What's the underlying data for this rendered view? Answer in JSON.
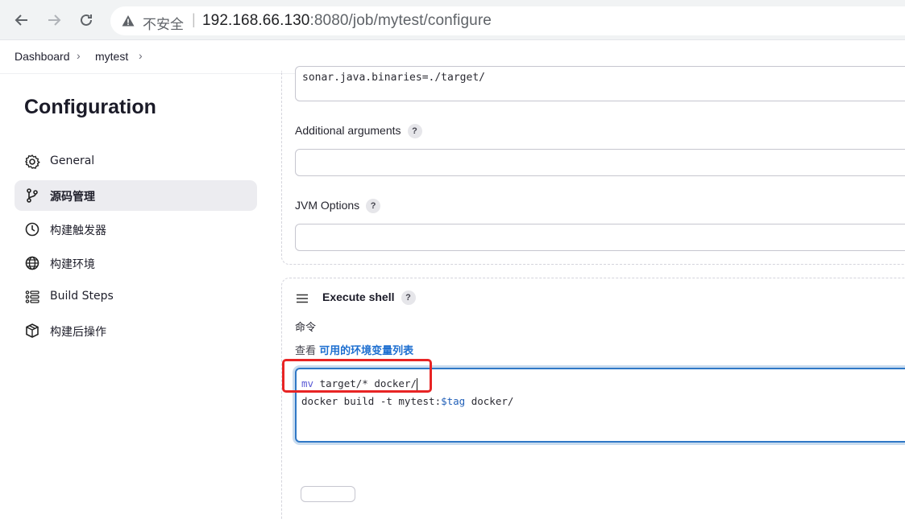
{
  "browser": {
    "security_label": "不安全",
    "url_host": "192.168.66.130",
    "url_path": ":8080/job/mytest/configure"
  },
  "breadcrumb": {
    "items": [
      "Dashboard",
      "mytest"
    ]
  },
  "sidebar": {
    "title": "Configuration",
    "items": [
      {
        "label": "General",
        "icon": "gear-icon"
      },
      {
        "label": "源码管理",
        "icon": "branch-icon",
        "active": true
      },
      {
        "label": "构建触发器",
        "icon": "clock-icon"
      },
      {
        "label": "构建环境",
        "icon": "globe-icon"
      },
      {
        "label": "Build Steps",
        "icon": "list-icon"
      },
      {
        "label": "构建后操作",
        "icon": "box-icon"
      }
    ]
  },
  "sonar": {
    "properties_value": "sonar.java.binaries=./target/",
    "additional_args_label": "Additional arguments",
    "additional_args_value": "",
    "jvm_options_label": "JVM Options",
    "jvm_options_value": ""
  },
  "execute_shell": {
    "title": "Execute shell",
    "command_label": "命令",
    "env_prefix": "查看",
    "env_link": "可用的环境变量列表",
    "line1_cmd": "mv",
    "line1_rest": " target/* docker/",
    "line2_pre": "docker build -t mytest:",
    "line2_var": "$tag",
    "line2_post": " docker/"
  },
  "help_symbol": "?",
  "colors": {
    "accent": "#2f78c6",
    "link": "#1e6fd0",
    "annotation": "#e82424",
    "active_bg": "#ececf0"
  }
}
